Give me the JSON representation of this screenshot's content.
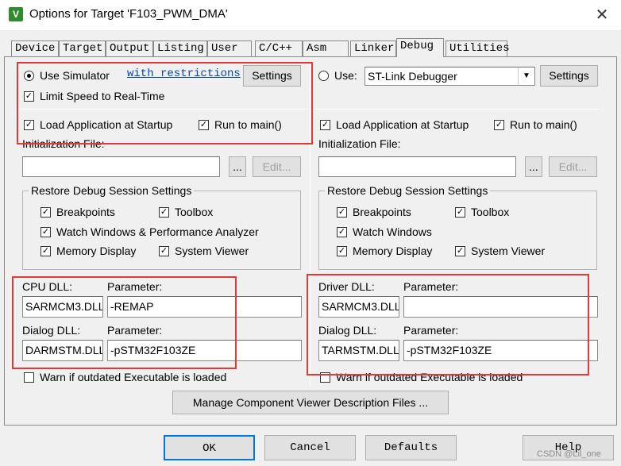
{
  "window": {
    "title": "Options for Target 'F103_PWM_DMA'",
    "close_glyph": "✕"
  },
  "tabs": [
    {
      "label": "Device"
    },
    {
      "label": "Target"
    },
    {
      "label": "Output"
    },
    {
      "label": "Listing"
    },
    {
      "label": "User"
    },
    {
      "label": "C/C++"
    },
    {
      "label": "Asm"
    },
    {
      "label": "Linker"
    },
    {
      "label": "Debug",
      "active": true
    },
    {
      "label": "Utilities"
    }
  ],
  "left": {
    "use_simulator": "Use Simulator",
    "restrictions_link": "with restrictions",
    "settings_label": "Settings",
    "limit_speed": "Limit Speed to Real-Time",
    "load_app": "Load Application at Startup",
    "run_to_main": "Run to main()",
    "init_file_label": "Initialization File:",
    "init_file_value": "",
    "browse_label": "...",
    "edit_label": "Edit...",
    "restore_title": "Restore Debug Session Settings",
    "breakpoints": "Breakpoints",
    "toolbox": "Toolbox",
    "watch_windows": "Watch Windows & Performance Analyzer",
    "memory_display": "Memory Display",
    "system_viewer": "System Viewer",
    "cpu_dll_label": "CPU DLL:",
    "parameter_label": "Parameter:",
    "cpu_dll_value": "SARMCM3.DLL",
    "cpu_param_value": "-REMAP",
    "dialog_dll_label": "Dialog DLL:",
    "dialog_dll_value": "DARMSTM.DLL",
    "dialog_param_value": "-pSTM32F103ZE",
    "warn_outdated": "Warn if outdated Executable is loaded"
  },
  "right": {
    "use_label": "Use:",
    "debugger_value": "ST-Link Debugger",
    "settings_label": "Settings",
    "load_app": "Load Application at Startup",
    "run_to_main": "Run to main()",
    "init_file_label": "Initialization File:",
    "init_file_value": "",
    "browse_label": "...",
    "edit_label": "Edit...",
    "restore_title": "Restore Debug Session Settings",
    "breakpoints": "Breakpoints",
    "toolbox": "Toolbox",
    "watch_windows": "Watch Windows",
    "memory_display": "Memory Display",
    "system_viewer": "System Viewer",
    "driver_dll_label": "Driver DLL:",
    "parameter_label": "Parameter:",
    "driver_dll_value": "SARMCM3.DLL",
    "driver_param_value": "",
    "dialog_dll_label": "Dialog DLL:",
    "dialog_dll_value": "TARMSTM.DLL",
    "dialog_param_value": "-pSTM32F103ZE",
    "warn_outdated": "Warn if outdated Executable is loaded"
  },
  "manage_button": "Manage Component Viewer Description Files ...",
  "footer": {
    "ok": "OK",
    "cancel": "Cancel",
    "defaults": "Defaults",
    "help": "Help"
  },
  "watermark": "CSDN @Lil_one",
  "colors": {
    "highlight_box": "#e53935",
    "link": "#0645ad",
    "dialog_bg": "#f0f0f0"
  }
}
